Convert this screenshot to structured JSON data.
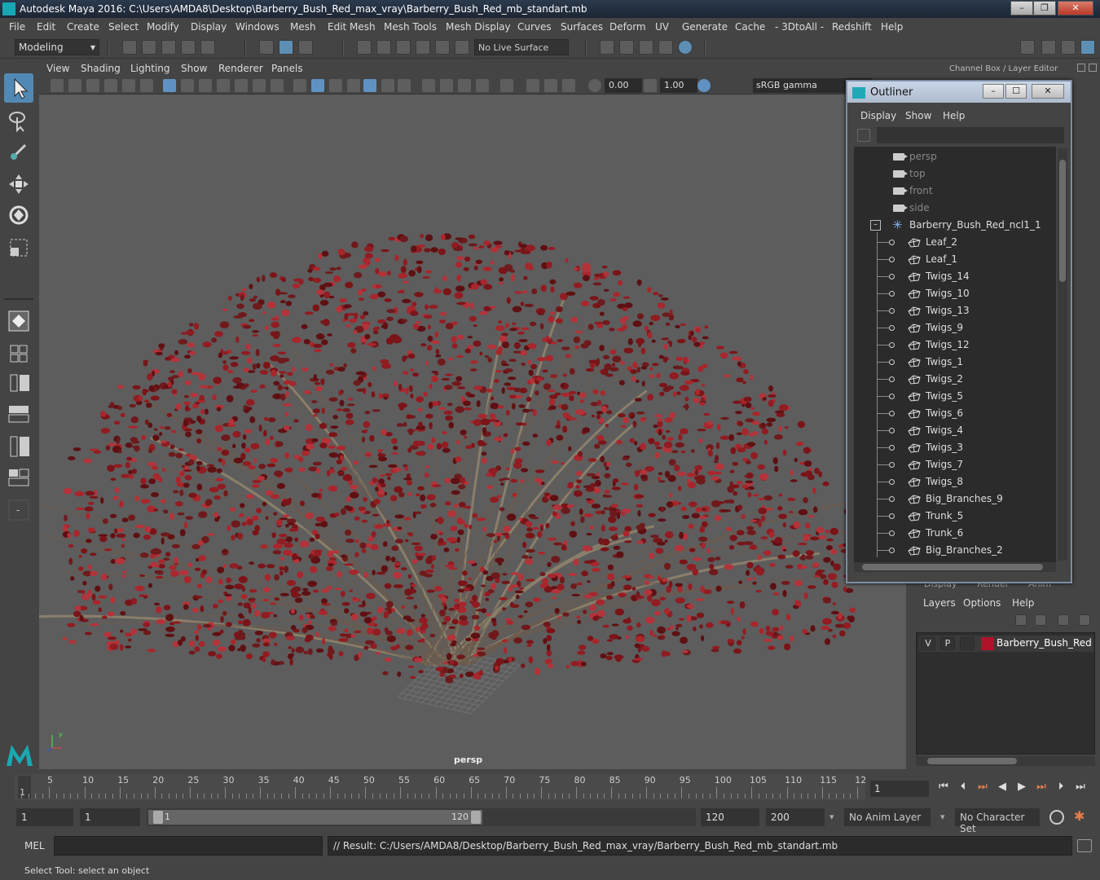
{
  "app": {
    "title": "Autodesk Maya 2016: C:\\Users\\AMDA8\\Desktop\\Barberry_Bush_Red_max_vray\\Barberry_Bush_Red_mb_standart.mb"
  },
  "menubar": [
    "File",
    "Edit",
    "Create",
    "Select",
    "Modify",
    "Display",
    "Windows",
    "Mesh",
    "Edit Mesh",
    "Mesh Tools",
    "Mesh Display",
    "Curves",
    "Surfaces",
    "Deform",
    "UV",
    "Generate",
    "Cache",
    "- 3DtoAll -",
    "Redshift",
    "Help"
  ],
  "statusline": {
    "mode": "Modeling",
    "live_surface": "No Live Surface"
  },
  "viewport": {
    "menus": [
      "View",
      "Shading",
      "Lighting",
      "Show",
      "Renderer",
      "Panels"
    ],
    "exposure": "0.00",
    "gamma": "1.00",
    "color_space": "sRGB gamma",
    "camera_label": "persp"
  },
  "channelbox": {
    "title": "Channel Box / Layer Editor"
  },
  "outliner": {
    "title": "Outliner",
    "menus": [
      "Display",
      "Show",
      "Help"
    ],
    "cameras": [
      "persp",
      "top",
      "front",
      "side"
    ],
    "group": "Barberry_Bush_Red_ncl1_1",
    "children": [
      "Leaf_2",
      "Leaf_1",
      "Twigs_14",
      "Twigs_10",
      "Twigs_13",
      "Twigs_9",
      "Twigs_12",
      "Twigs_1",
      "Twigs_2",
      "Twigs_5",
      "Twigs_6",
      "Twigs_4",
      "Twigs_3",
      "Twigs_7",
      "Twigs_8",
      "Big_Branches_9",
      "Trunk_5",
      "Trunk_6",
      "Big_Branches_2"
    ]
  },
  "layer_editor": {
    "tabs": [
      "Display",
      "Render",
      "Anim"
    ],
    "menus": [
      "Layers",
      "Options",
      "Help"
    ],
    "layers": [
      {
        "v": "V",
        "p": "P",
        "name": "Barberry_Bush_Red",
        "color": "#b0122a"
      }
    ]
  },
  "timeslider": {
    "ticks": [
      "5",
      "10",
      "15",
      "20",
      "25",
      "30",
      "35",
      "40",
      "45",
      "50",
      "55",
      "60",
      "65",
      "70",
      "75",
      "80",
      "85",
      "90",
      "95",
      "100",
      "105",
      "110",
      "115",
      "12"
    ],
    "current_frame": "1",
    "frame_field": "1"
  },
  "range": {
    "start": "1",
    "playback_start": "1",
    "slider_start": "1",
    "slider_end": "120",
    "playback_end": "120",
    "end": "200",
    "anim_layer": "No Anim Layer",
    "character_set": "No Character Set"
  },
  "commandline": {
    "label": "MEL",
    "result": "// Result: C:/Users/AMDA8/Desktop/Barberry_Bush_Red_max_vray/Barberry_Bush_Red_mb_standart.mb"
  },
  "helpline": {
    "text": "Select Tool: select an object"
  },
  "colors": {
    "accent": "#5289b4",
    "bush": "#8e1a22",
    "viewport_bg": "#5d5d5d"
  }
}
